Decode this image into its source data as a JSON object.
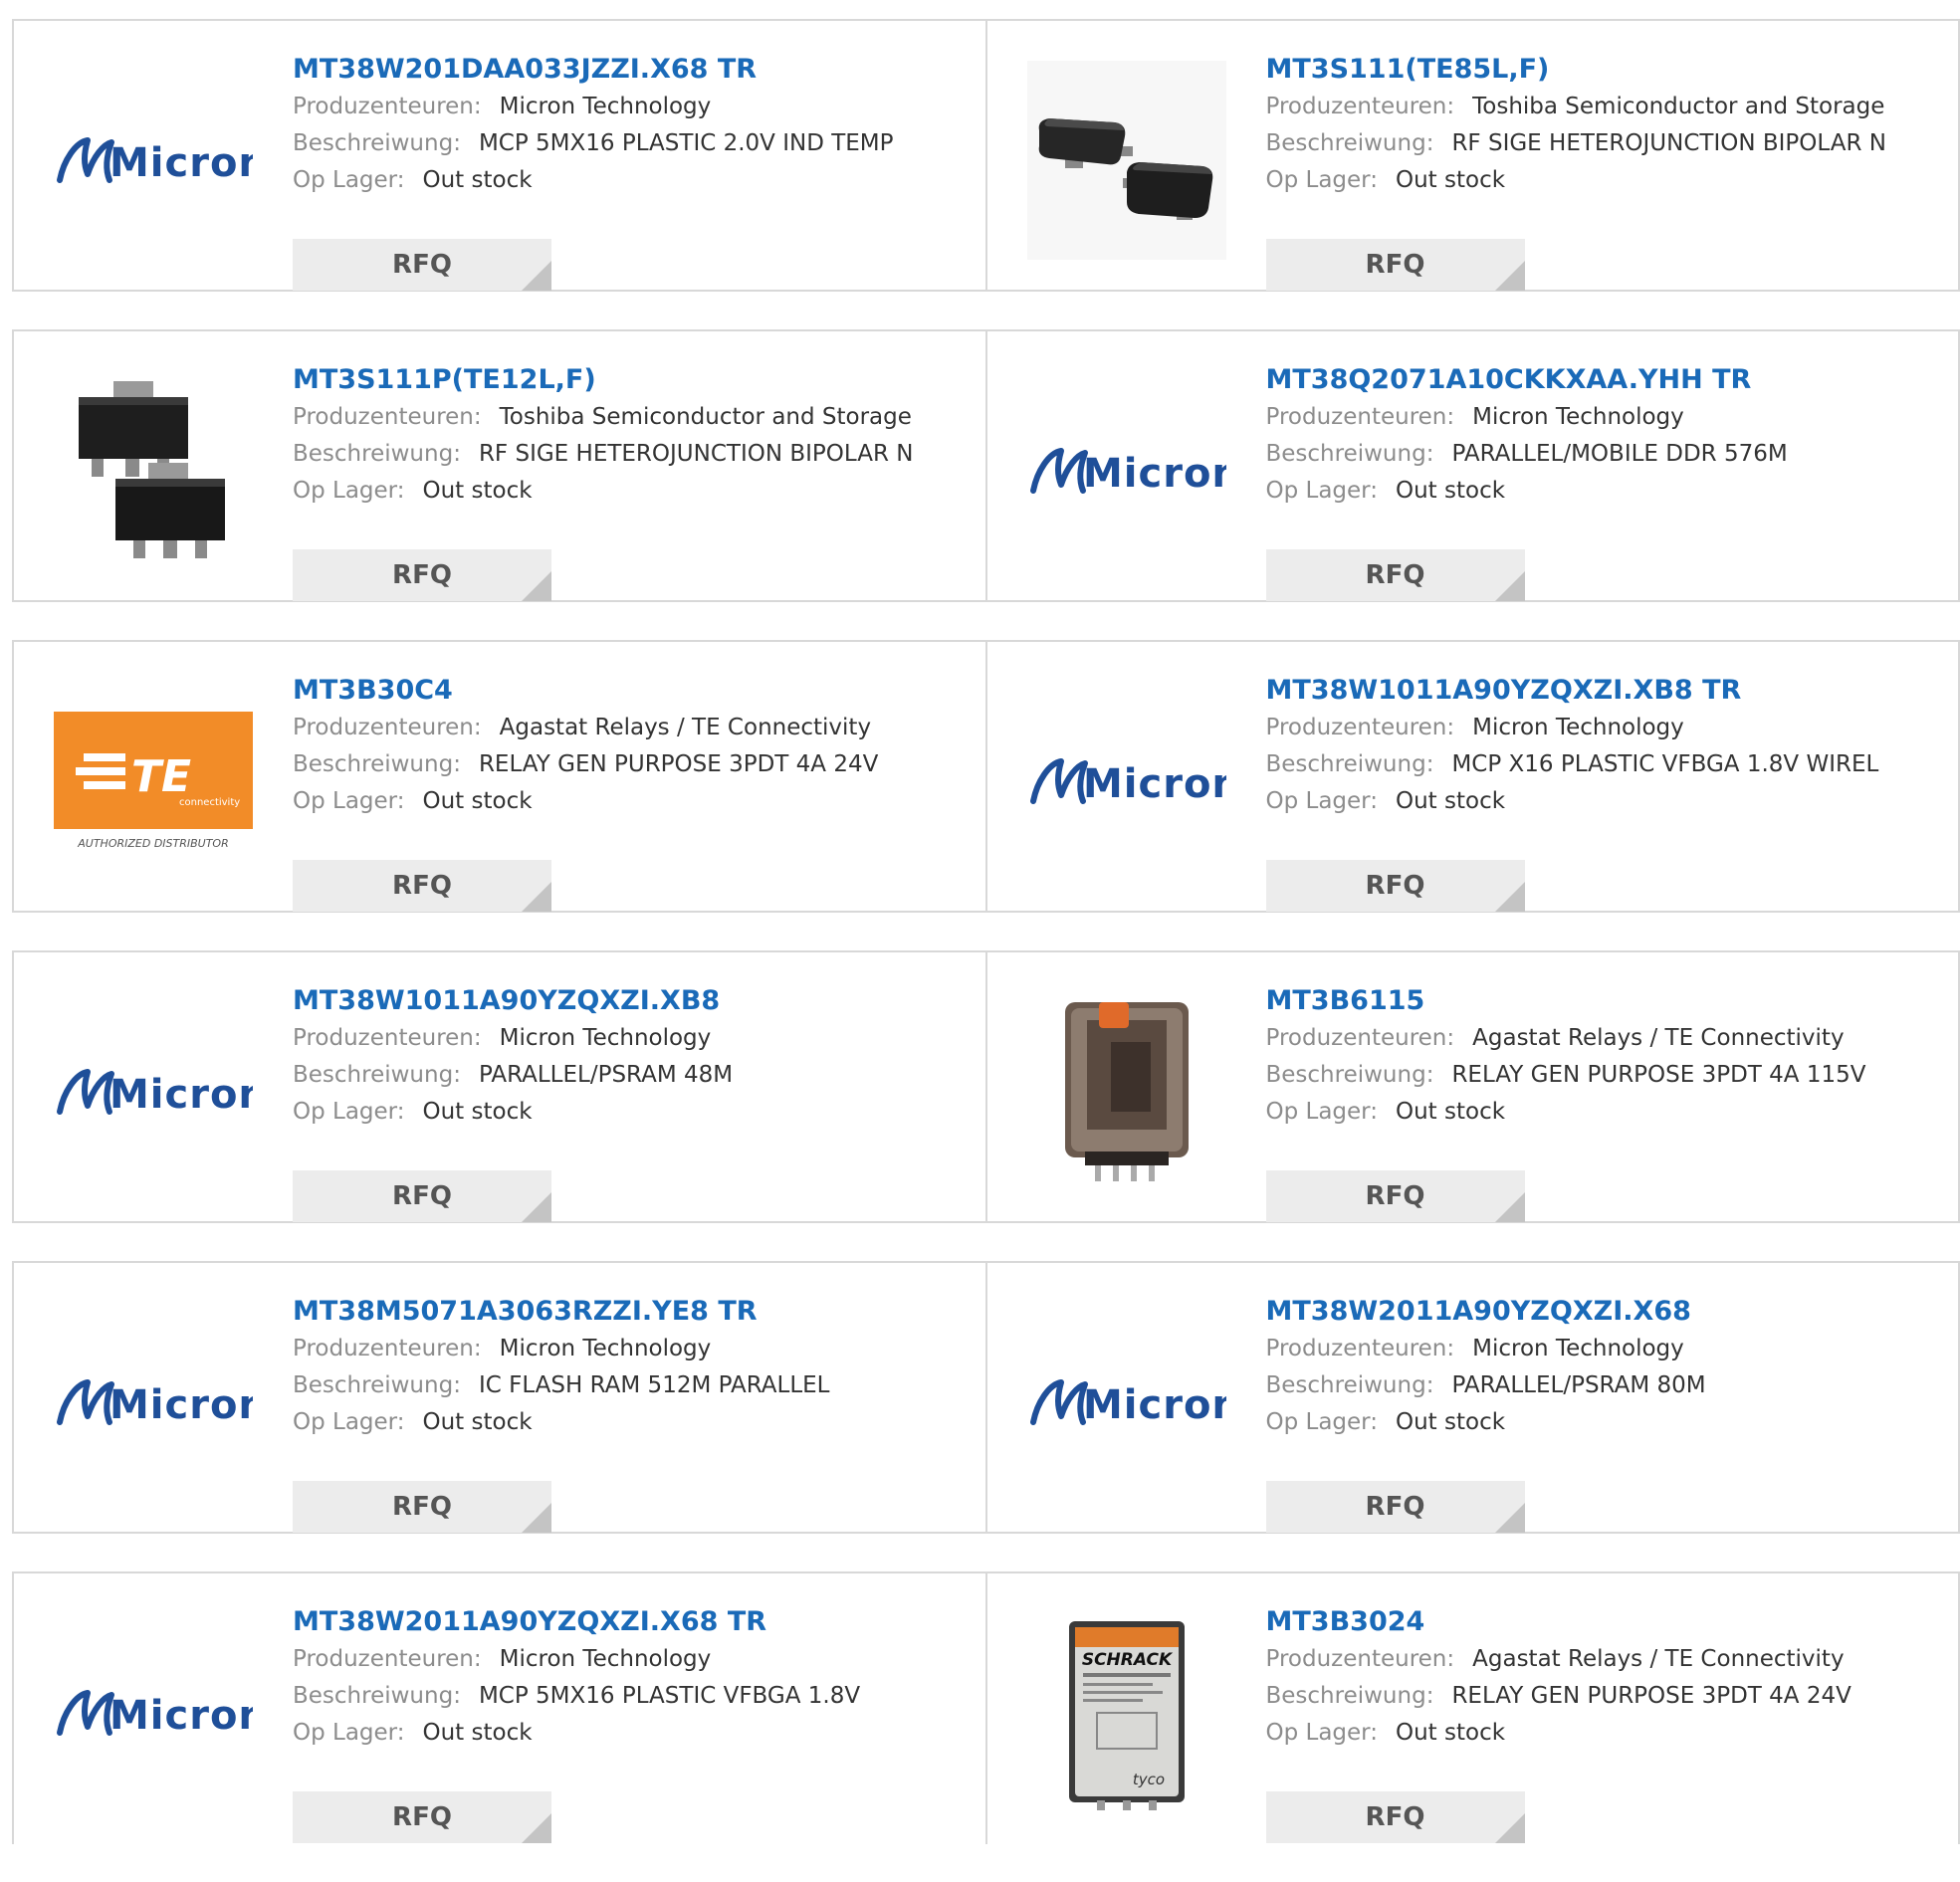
{
  "labels": {
    "manufacturer": "Produzenteuren:",
    "description": "Beschreiwung:",
    "stock": "Op Lager:",
    "rfq": "RFQ"
  },
  "logos": {
    "micron_text": "Micron",
    "te_text": "TE",
    "te_sub": "connectivity",
    "te_tagline": "AUTHORIZED DISTRIBUTOR",
    "schrack_text": "SCHRACK",
    "tyco_text": "tyco"
  },
  "colors": {
    "link": "#1a6ab8",
    "label": "#8c8c8c",
    "value": "#333333",
    "micron_blue": "#1f4f99",
    "te_orange": "#f28c28",
    "button_bg": "#ececec"
  },
  "products": [
    {
      "name": "MT38W201DAA033JZZI.X68 TR",
      "manufacturer": "Micron Technology",
      "description": "MCP 5MX16 PLASTIC 2.0V IND TEMP",
      "stock": "Out stock",
      "image": "micron-logo"
    },
    {
      "name": "MT3S111(TE85L,F)",
      "manufacturer": "Toshiba Semiconductor and Storage",
      "description": "RF SIGE HETEROJUNCTION BIPOLAR N",
      "stock": "Out stock",
      "image": "sot23-chip"
    },
    {
      "name": "MT3S111P(TE12L,F)",
      "manufacturer": "Toshiba Semiconductor and Storage",
      "description": "RF SIGE HETEROJUNCTION BIPOLAR N",
      "stock": "Out stock",
      "image": "sot89-chip"
    },
    {
      "name": "MT38Q2071A10CKKXAA.YHH TR",
      "manufacturer": "Micron Technology",
      "description": "PARALLEL/MOBILE DDR 576M",
      "stock": "Out stock",
      "image": "micron-logo"
    },
    {
      "name": "MT3B30C4",
      "manufacturer": "Agastat Relays / TE Connectivity",
      "description": "RELAY GEN PURPOSE 3PDT 4A 24V",
      "stock": "Out stock",
      "image": "te-logo"
    },
    {
      "name": "MT38W1011A90YZQXZI.XB8 TR",
      "manufacturer": "Micron Technology",
      "description": "MCP X16 PLASTIC VFBGA 1.8V WIREL",
      "stock": "Out stock",
      "image": "micron-logo"
    },
    {
      "name": "MT38W1011A90YZQXZI.XB8",
      "manufacturer": "Micron Technology",
      "description": "PARALLEL/PSRAM 48M",
      "stock": "Out stock",
      "image": "micron-logo"
    },
    {
      "name": "MT3B6115",
      "manufacturer": "Agastat Relays / TE Connectivity",
      "description": "RELAY GEN PURPOSE 3PDT 4A 115V",
      "stock": "Out stock",
      "image": "relay-clear"
    },
    {
      "name": "MT38M5071A3063RZZI.YE8 TR",
      "manufacturer": "Micron Technology",
      "description": "IC FLASH RAM 512M PARALLEL",
      "stock": "Out stock",
      "image": "micron-logo"
    },
    {
      "name": "MT38W2011A90YZQXZI.X68",
      "manufacturer": "Micron Technology",
      "description": "PARALLEL/PSRAM 80M",
      "stock": "Out stock",
      "image": "micron-logo"
    },
    {
      "name": "MT38W2011A90YZQXZI.X68 TR",
      "manufacturer": "Micron Technology",
      "description": "MCP 5MX16 PLASTIC VFBGA 1.8V",
      "stock": "Out stock",
      "image": "micron-logo"
    },
    {
      "name": "MT3B3024",
      "manufacturer": "Agastat Relays / TE Connectivity",
      "description": "RELAY GEN PURPOSE 3PDT 4A 24V",
      "stock": "Out stock",
      "image": "relay-schrack"
    }
  ]
}
